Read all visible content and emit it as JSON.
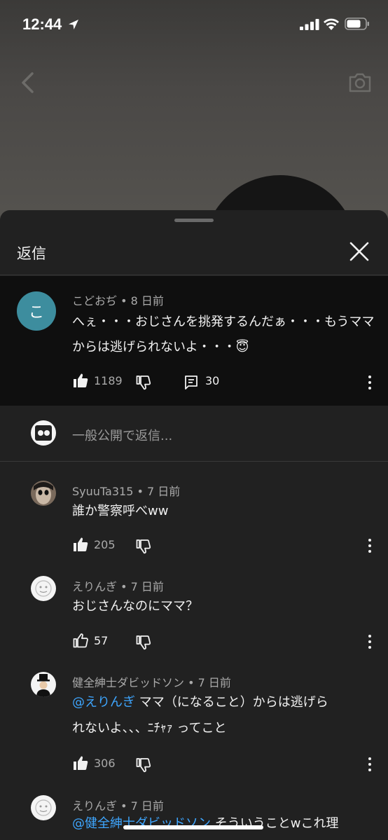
{
  "status": {
    "time": "12:44"
  },
  "sheet": {
    "title": "返信"
  },
  "parent_comment": {
    "avatar_letter": "こ",
    "author_meta": "こどおぢ • 8 日前",
    "text_line1": "へぇ・・・おじさんを挑発するんだぁ・・・もうママ",
    "text_line2": "からは逃げられないよ・・・",
    "emoji": "😇",
    "likes": "1189",
    "replies": "30"
  },
  "reply_input": {
    "placeholder": "一般公開で返信..."
  },
  "replies": [
    {
      "author_meta": "SyuuTa315 • 7 日前",
      "text": "誰か警察呼べww",
      "likes": "205"
    },
    {
      "author_meta": "えりんぎ • 7 日前",
      "text": "おじさんなのにママ？",
      "likes": "57"
    },
    {
      "author_meta": "健全紳士ダビッドソン • 7 日前",
      "mention": "@えりんぎ",
      "text_line1": "  ママ（になること）からは逃げら",
      "text_line2": "れないよ、、、ﾆﾁｬｧ ってこと",
      "likes": "306"
    },
    {
      "author_meta": "えりんぎ • 7 日前",
      "mention": "@健全紳士ダビッドソン",
      "text_line1": "  そういうことwこれ理"
    }
  ],
  "colors": {
    "sheet_bg": "#212121",
    "parent_bg": "#0f0f0f",
    "mention": "#3ea6ff",
    "avatar_teal": "#3d8d9e"
  }
}
